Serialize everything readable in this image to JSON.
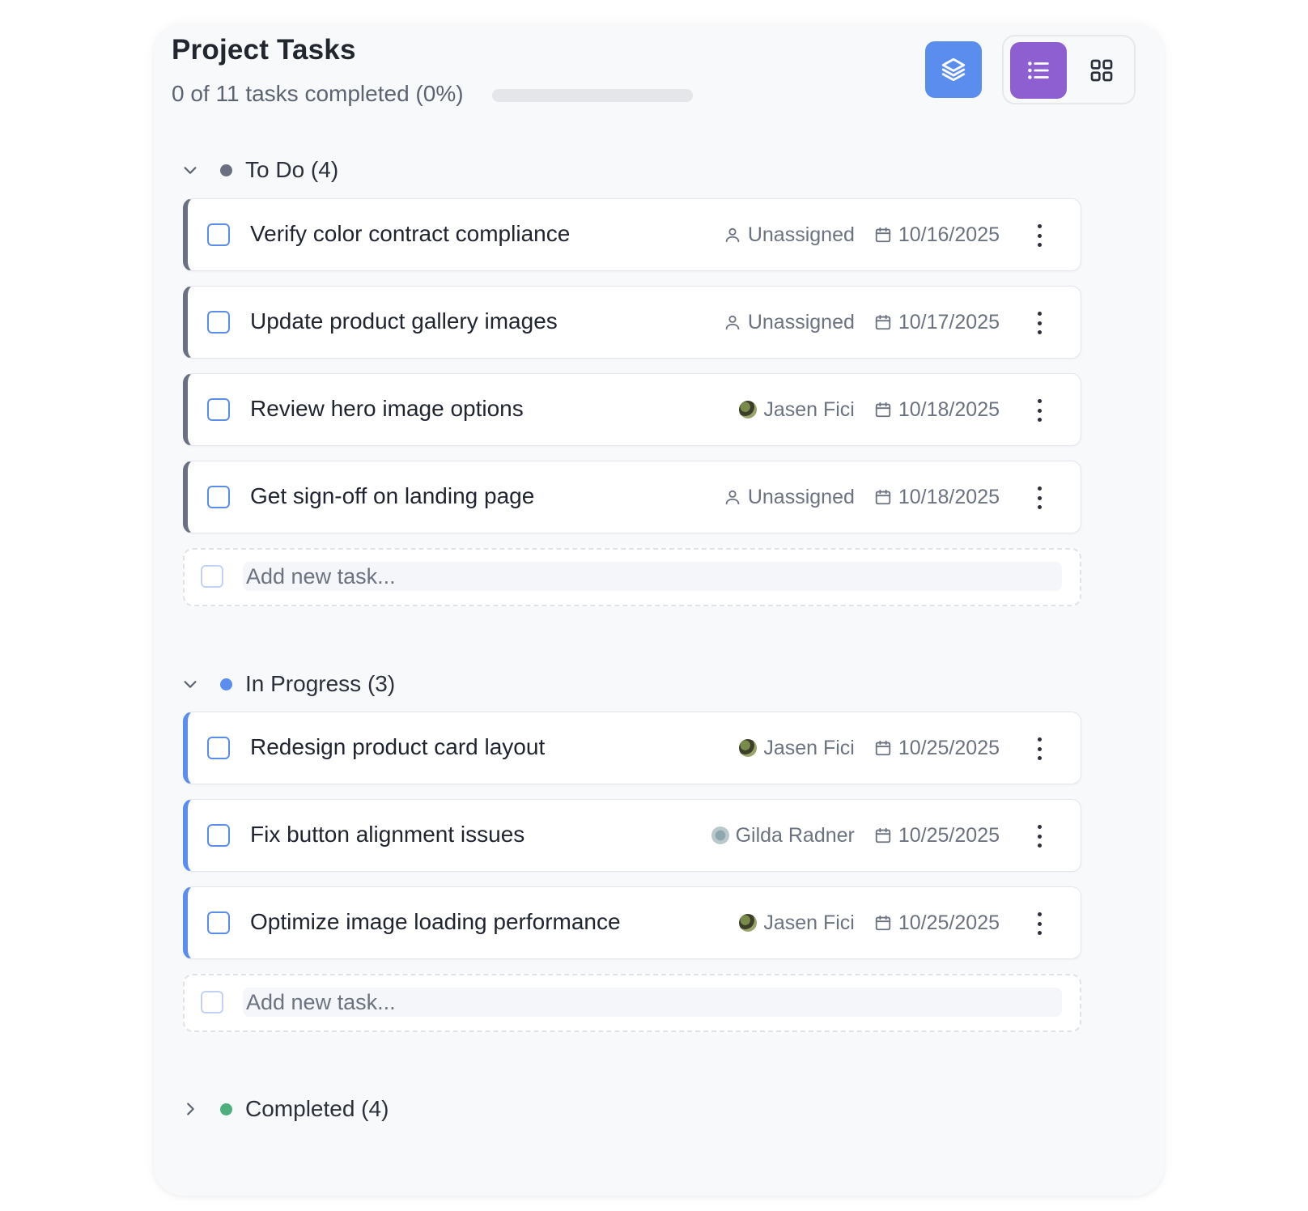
{
  "header": {
    "title": "Project Tasks",
    "progress_text": "0 of 11 tasks completed (0%)",
    "progress_fraction": 0,
    "colors": {
      "accent_blue": "#5b8def",
      "accent_purple": "#8e5fd0"
    },
    "icons": {
      "layers": "layers-icon",
      "list": "list-icon",
      "grid": "grid-icon"
    }
  },
  "sections": {
    "todo": {
      "label": "To Do (4)",
      "color": "#6b7080",
      "expanded": true,
      "tasks": [
        {
          "title": "Verify color contract compliance",
          "assignee": "Unassigned",
          "avatar": "user-icon",
          "date": "10/16/2025"
        },
        {
          "title": "Update product gallery images",
          "assignee": "Unassigned",
          "avatar": "user-icon",
          "date": "10/17/2025"
        },
        {
          "title": "Review hero image options",
          "assignee": "Jasen Fici",
          "avatar": "photo",
          "date": "10/18/2025"
        },
        {
          "title": "Get sign-off on landing page",
          "assignee": "Unassigned",
          "avatar": "user-icon",
          "date": "10/18/2025"
        }
      ],
      "add_placeholder": "Add new task..."
    },
    "in_progress": {
      "label": "In Progress (3)",
      "color": "#5b8def",
      "expanded": true,
      "tasks": [
        {
          "title": "Redesign product card layout",
          "assignee": "Jasen Fici",
          "avatar": "photo",
          "date": "10/25/2025"
        },
        {
          "title": "Fix button alignment issues",
          "assignee": "Gilda Radner",
          "avatar": "photo",
          "date": "10/25/2025"
        },
        {
          "title": "Optimize image loading performance",
          "assignee": "Jasen Fici",
          "avatar": "photo",
          "date": "10/25/2025"
        }
      ],
      "add_placeholder": "Add new task..."
    },
    "completed": {
      "label": "Completed (4)",
      "color": "#4caf7d",
      "expanded": false
    }
  }
}
